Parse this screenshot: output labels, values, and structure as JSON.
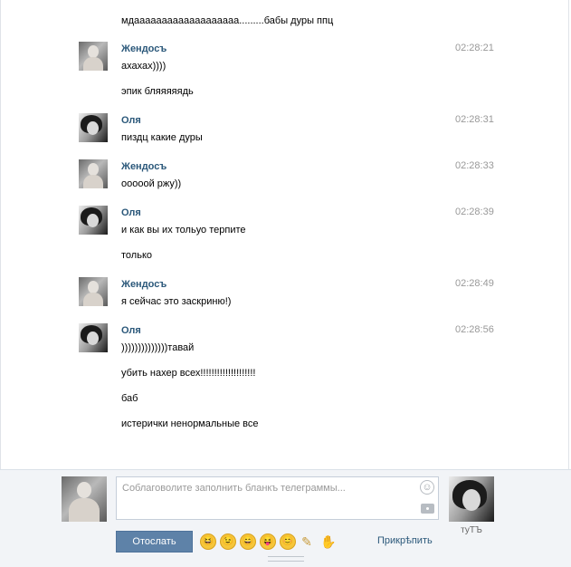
{
  "messages": {
    "m0_text": "мдааааааааааааааааааа.........бабы дуры ппц",
    "g1_author": "Жендосъ",
    "g1_time": "02:28:21",
    "g1_line1": "ахахах))))",
    "g1_line2": "эпик бляяяяядь",
    "g2_author": "Оля",
    "g2_time": "02:28:31",
    "g2_line1": "пиздц какие дуры",
    "g3_author": "Жендосъ",
    "g3_time": "02:28:33",
    "g3_line1": "ооооой ржу))",
    "g4_author": "Оля",
    "g4_time": "02:28:39",
    "g4_line1": "и как вы их тольуо терпите",
    "g4_line2": "только",
    "g5_author": "Жендосъ",
    "g5_time": "02:28:49",
    "g5_line1": "я сейчас это заскриню!)",
    "g6_author": "Оля",
    "g6_time": "02:28:56",
    "g6_line1": "))))))))))))))тавай",
    "g6_line2": "убить нахер всех!!!!!!!!!!!!!!!!!!!!",
    "g6_line3": "баб",
    "g6_line4": "истерички ненормальные все"
  },
  "composer": {
    "placeholder": "Соблаговолите заполнить бланкъ телеграммы...",
    "send_label": "Отослать",
    "attach_label": "Прикрѣпить",
    "peer_name": "туТЪ",
    "emojis": [
      "😆",
      "😉",
      "😄",
      "😝",
      "😊"
    ],
    "emoji_names": [
      "laughing-emoji-icon",
      "wink-emoji-icon",
      "grin-emoji-icon",
      "tongue-emoji-icon",
      "smile-emoji-icon"
    ]
  },
  "colors": {
    "author": "#2b587a",
    "time": "#999999",
    "send_button": "#5e82a8",
    "composer_bg": "#f2f4f7"
  }
}
